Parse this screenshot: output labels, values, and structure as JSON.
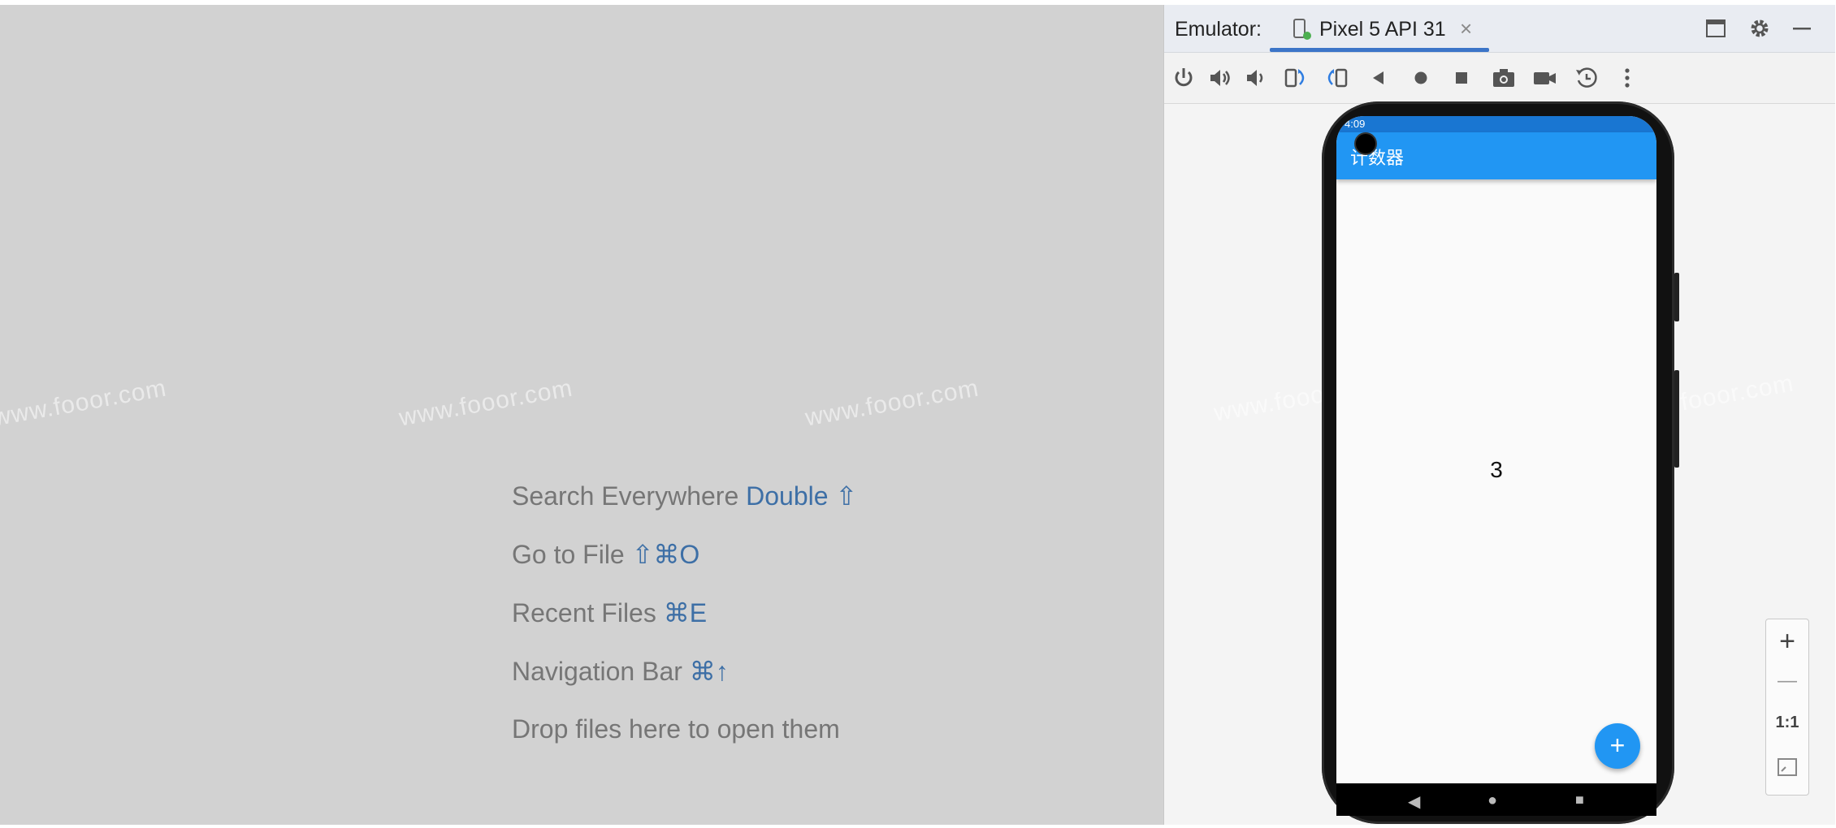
{
  "editor": {
    "hints": [
      {
        "label": "Search Everywhere",
        "shortcut": "Double ⇧"
      },
      {
        "label": "Go to File",
        "shortcut": "⇧⌘O"
      },
      {
        "label": "Recent Files",
        "shortcut": "⌘E"
      },
      {
        "label": "Navigation Bar",
        "shortcut": "⌘↑"
      },
      {
        "label": "Drop files here to open them",
        "shortcut": ""
      }
    ],
    "watermark": "www.fooor.com"
  },
  "emulator": {
    "label": "Emulator:",
    "tab_title": "Pixel 5 API 31",
    "close_glyph": "×",
    "toolbar_icons": [
      "power-icon",
      "volume-up-icon",
      "volume-down-icon",
      "rotate-left-icon",
      "rotate-right-icon",
      "back-icon",
      "home-icon",
      "overview-icon",
      "screenshot-icon",
      "screen-record-icon",
      "snapshot-icon",
      "more-icon"
    ]
  },
  "device": {
    "status_time": "4:09",
    "app_title": "计数器",
    "counter_value": "3",
    "fab_glyph": "+",
    "nav_back": "◀",
    "nav_home": "●",
    "nav_recents": "■"
  },
  "zoom": {
    "plus": "+",
    "minus": "—",
    "one_to_one": "1:1"
  },
  "colors": {
    "accent": "#2196f3",
    "shortcut": "#3d6fa6",
    "editor_bg": "#d2d2d2"
  }
}
